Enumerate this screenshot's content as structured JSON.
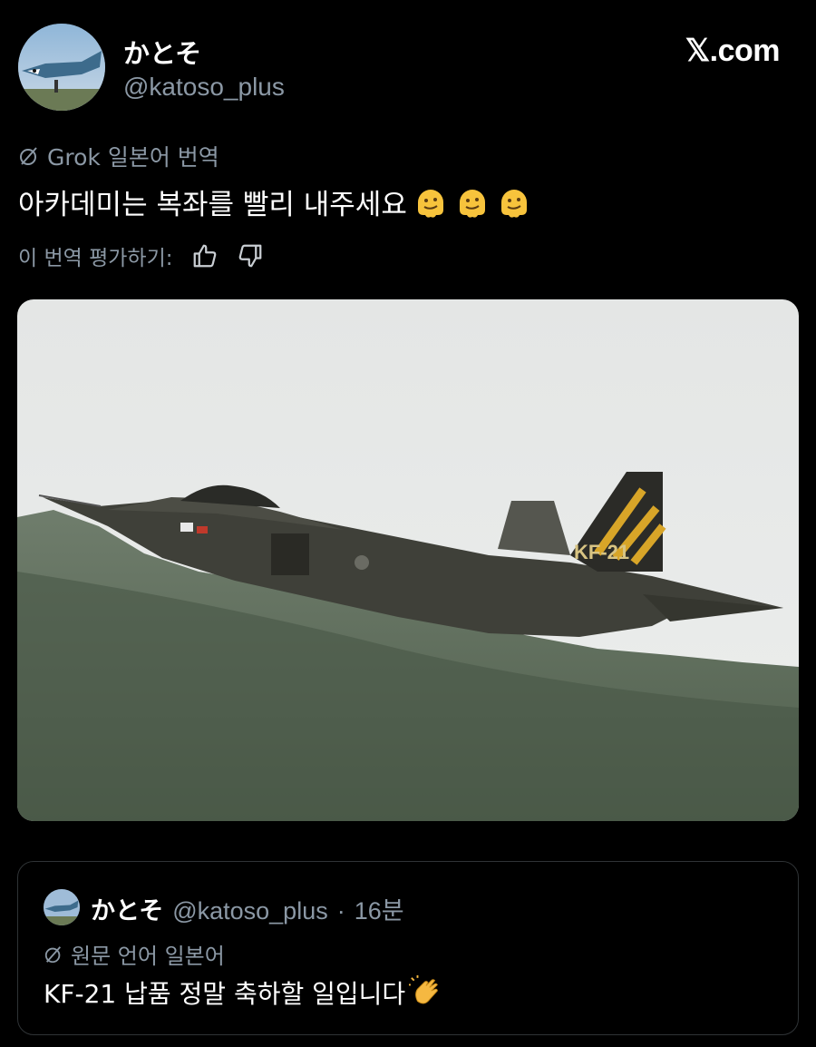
{
  "author": {
    "display_name": "かとそ",
    "handle": "@katoso_plus"
  },
  "brand": {
    "logo_text": "𝕏.com"
  },
  "translation": {
    "label": "Grok 일본어 번역",
    "text": "아카데미는 복좌를 빨리 내주세요",
    "emojis": [
      "melting-face-emoji",
      "melting-face-emoji",
      "melting-face-emoji"
    ],
    "rate_prompt": "이 번역 평가하기:"
  },
  "media": {
    "alt_icon": "fighter-jet-photo",
    "tail_text": "KF-21"
  },
  "quote": {
    "display_name": "かとそ",
    "handle": "@katoso_plus",
    "separator": "·",
    "time": "16분",
    "lang_label": "원문 언어 일본어",
    "text": "KF-21 납품 정말 축하할 일입니다",
    "emoji": "clapping-hands-emoji"
  },
  "colors": {
    "background": "#000000",
    "secondary_text": "#8b98a5",
    "border": "#2f3336"
  }
}
